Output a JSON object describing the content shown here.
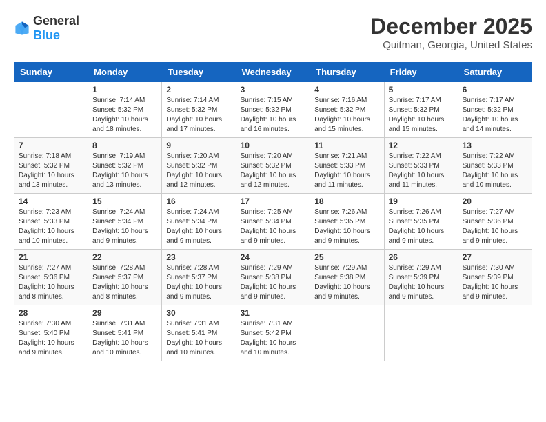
{
  "header": {
    "logo_general": "General",
    "logo_blue": "Blue",
    "month_title": "December 2025",
    "location": "Quitman, Georgia, United States"
  },
  "days_of_week": [
    "Sunday",
    "Monday",
    "Tuesday",
    "Wednesday",
    "Thursday",
    "Friday",
    "Saturday"
  ],
  "weeks": [
    [
      {
        "day": "",
        "info": ""
      },
      {
        "day": "1",
        "info": "Sunrise: 7:14 AM\nSunset: 5:32 PM\nDaylight: 10 hours\nand 18 minutes."
      },
      {
        "day": "2",
        "info": "Sunrise: 7:14 AM\nSunset: 5:32 PM\nDaylight: 10 hours\nand 17 minutes."
      },
      {
        "day": "3",
        "info": "Sunrise: 7:15 AM\nSunset: 5:32 PM\nDaylight: 10 hours\nand 16 minutes."
      },
      {
        "day": "4",
        "info": "Sunrise: 7:16 AM\nSunset: 5:32 PM\nDaylight: 10 hours\nand 15 minutes."
      },
      {
        "day": "5",
        "info": "Sunrise: 7:17 AM\nSunset: 5:32 PM\nDaylight: 10 hours\nand 15 minutes."
      },
      {
        "day": "6",
        "info": "Sunrise: 7:17 AM\nSunset: 5:32 PM\nDaylight: 10 hours\nand 14 minutes."
      }
    ],
    [
      {
        "day": "7",
        "info": "Sunrise: 7:18 AM\nSunset: 5:32 PM\nDaylight: 10 hours\nand 13 minutes."
      },
      {
        "day": "8",
        "info": "Sunrise: 7:19 AM\nSunset: 5:32 PM\nDaylight: 10 hours\nand 13 minutes."
      },
      {
        "day": "9",
        "info": "Sunrise: 7:20 AM\nSunset: 5:32 PM\nDaylight: 10 hours\nand 12 minutes."
      },
      {
        "day": "10",
        "info": "Sunrise: 7:20 AM\nSunset: 5:32 PM\nDaylight: 10 hours\nand 12 minutes."
      },
      {
        "day": "11",
        "info": "Sunrise: 7:21 AM\nSunset: 5:33 PM\nDaylight: 10 hours\nand 11 minutes."
      },
      {
        "day": "12",
        "info": "Sunrise: 7:22 AM\nSunset: 5:33 PM\nDaylight: 10 hours\nand 11 minutes."
      },
      {
        "day": "13",
        "info": "Sunrise: 7:22 AM\nSunset: 5:33 PM\nDaylight: 10 hours\nand 10 minutes."
      }
    ],
    [
      {
        "day": "14",
        "info": "Sunrise: 7:23 AM\nSunset: 5:33 PM\nDaylight: 10 hours\nand 10 minutes."
      },
      {
        "day": "15",
        "info": "Sunrise: 7:24 AM\nSunset: 5:34 PM\nDaylight: 10 hours\nand 9 minutes."
      },
      {
        "day": "16",
        "info": "Sunrise: 7:24 AM\nSunset: 5:34 PM\nDaylight: 10 hours\nand 9 minutes."
      },
      {
        "day": "17",
        "info": "Sunrise: 7:25 AM\nSunset: 5:34 PM\nDaylight: 10 hours\nand 9 minutes."
      },
      {
        "day": "18",
        "info": "Sunrise: 7:26 AM\nSunset: 5:35 PM\nDaylight: 10 hours\nand 9 minutes."
      },
      {
        "day": "19",
        "info": "Sunrise: 7:26 AM\nSunset: 5:35 PM\nDaylight: 10 hours\nand 9 minutes."
      },
      {
        "day": "20",
        "info": "Sunrise: 7:27 AM\nSunset: 5:36 PM\nDaylight: 10 hours\nand 9 minutes."
      }
    ],
    [
      {
        "day": "21",
        "info": "Sunrise: 7:27 AM\nSunset: 5:36 PM\nDaylight: 10 hours\nand 8 minutes."
      },
      {
        "day": "22",
        "info": "Sunrise: 7:28 AM\nSunset: 5:37 PM\nDaylight: 10 hours\nand 8 minutes."
      },
      {
        "day": "23",
        "info": "Sunrise: 7:28 AM\nSunset: 5:37 PM\nDaylight: 10 hours\nand 9 minutes."
      },
      {
        "day": "24",
        "info": "Sunrise: 7:29 AM\nSunset: 5:38 PM\nDaylight: 10 hours\nand 9 minutes."
      },
      {
        "day": "25",
        "info": "Sunrise: 7:29 AM\nSunset: 5:38 PM\nDaylight: 10 hours\nand 9 minutes."
      },
      {
        "day": "26",
        "info": "Sunrise: 7:29 AM\nSunset: 5:39 PM\nDaylight: 10 hours\nand 9 minutes."
      },
      {
        "day": "27",
        "info": "Sunrise: 7:30 AM\nSunset: 5:39 PM\nDaylight: 10 hours\nand 9 minutes."
      }
    ],
    [
      {
        "day": "28",
        "info": "Sunrise: 7:30 AM\nSunset: 5:40 PM\nDaylight: 10 hours\nand 9 minutes."
      },
      {
        "day": "29",
        "info": "Sunrise: 7:31 AM\nSunset: 5:41 PM\nDaylight: 10 hours\nand 10 minutes."
      },
      {
        "day": "30",
        "info": "Sunrise: 7:31 AM\nSunset: 5:41 PM\nDaylight: 10 hours\nand 10 minutes."
      },
      {
        "day": "31",
        "info": "Sunrise: 7:31 AM\nSunset: 5:42 PM\nDaylight: 10 hours\nand 10 minutes."
      },
      {
        "day": "",
        "info": ""
      },
      {
        "day": "",
        "info": ""
      },
      {
        "day": "",
        "info": ""
      }
    ]
  ]
}
